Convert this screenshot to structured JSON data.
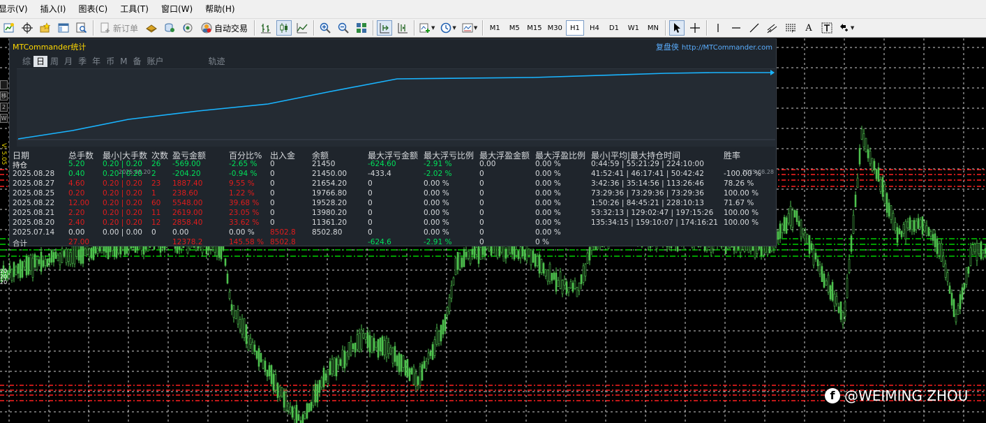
{
  "menu": [
    "显示(V)",
    "插入(I)",
    "图表(C)",
    "工具(T)",
    "窗口(W)",
    "帮助(H)"
  ],
  "toolbar": {
    "new_order": "新订单",
    "auto_trade": "自动交易",
    "timeframes": [
      "M1",
      "M5",
      "M15",
      "M30",
      "H1",
      "H4",
      "D1",
      "W1",
      "MN"
    ],
    "active_timeframe": "H1",
    "text_tool": "A"
  },
  "left_panel": {
    "tabs": [
      "",
      "移",
      "2",
      "W"
    ],
    "vertical_label": "V: 5.05",
    "price_ticks": [
      "20",
      "20",
      "20"
    ]
  },
  "panel": {
    "title": "MTCommander统计",
    "right_title": "复盘侠",
    "right_url": "http://MTCommander.com",
    "tabs": [
      "综",
      "日",
      "周",
      "月",
      "季",
      "年",
      "币",
      "M",
      "备",
      "账户",
      "轨迹"
    ],
    "active_tab": "日",
    "curve_date_left": "2025.08.20",
    "curve_date_right": "2025.08.28",
    "curve_color": "#19b4ff",
    "headers": [
      "日期",
      "总手数",
      "最小|大手数",
      "次数",
      "盈亏金额",
      "百分比%",
      "出入金",
      "余额",
      "最大浮亏金额",
      "最大浮亏比例",
      "最大浮盈金额",
      "最大浮盈比例",
      "最小|平均|最大持仓时间",
      "胜率"
    ],
    "rows": [
      {
        "date": "持仓",
        "lots": "5.20",
        "minmax": "0.20 | 0.20",
        "count": "26",
        "pnl": "-569.00",
        "pct": "-2.65 %",
        "io": "0",
        "balance": "21450",
        "max_loss": "-624.60",
        "max_loss_pct": "-2.91 %",
        "max_gain": "0.00",
        "max_gain_pct": "0.00 %",
        "hold": "0:44:59 | 55:21:29 | 224:10:00",
        "win": "",
        "tone": "g"
      },
      {
        "date": "2025.08.28",
        "lots": "0.40",
        "minmax": "0.20 | 0.20",
        "count": "2",
        "pnl": "-204.20",
        "pct": "-0.94 %",
        "io": "0",
        "balance": "21450.00",
        "max_loss": "-433.4",
        "max_loss_pct": "-2.02 %",
        "max_gain": "0",
        "max_gain_pct": "0.00 %",
        "hold": "41:52:41 | 46:17:41 | 50:42:42",
        "win": "-100.00 %",
        "tone": "g"
      },
      {
        "date": "2025.08.27",
        "lots": "4.60",
        "minmax": "0.20 | 0.20",
        "count": "23",
        "pnl": "1887.40",
        "pct": "9.55 %",
        "io": "0",
        "balance": "21654.20",
        "max_loss": "0",
        "max_loss_pct": "0.00 %",
        "max_gain": "0",
        "max_gain_pct": "0.00 %",
        "hold": "3:42:36 | 35:14:56 | 113:26:46",
        "win": "78.26 %",
        "tone": "r"
      },
      {
        "date": "2025.08.25",
        "lots": "0.20",
        "minmax": "0.20 | 0.20",
        "count": "1",
        "pnl": "238.60",
        "pct": "1.22 %",
        "io": "0",
        "balance": "19766.80",
        "max_loss": "0",
        "max_loss_pct": "0.00 %",
        "max_gain": "0",
        "max_gain_pct": "0.00 %",
        "hold": "73:29:36 | 73:29:36 | 73:29:36",
        "win": "100.00 %",
        "tone": "r"
      },
      {
        "date": "2025.08.22",
        "lots": "12.00",
        "minmax": "0.20 | 0.20",
        "count": "60",
        "pnl": "5548.00",
        "pct": "39.68 %",
        "io": "0",
        "balance": "19528.20",
        "max_loss": "0",
        "max_loss_pct": "0.00 %",
        "max_gain": "0",
        "max_gain_pct": "0.00 %",
        "hold": "1:50:26 | 84:45:21 | 228:10:13",
        "win": "71.67 %",
        "tone": "r"
      },
      {
        "date": "2025.08.21",
        "lots": "2.20",
        "minmax": "0.20 | 0.20",
        "count": "11",
        "pnl": "2619.00",
        "pct": "23.05 %",
        "io": "0",
        "balance": "13980.20",
        "max_loss": "0",
        "max_loss_pct": "0.00 %",
        "max_gain": "0",
        "max_gain_pct": "0.00 %",
        "hold": "53:32:13 | 129:02:47 | 197:15:26",
        "win": "100.00 %",
        "tone": "r"
      },
      {
        "date": "2025.08.20",
        "lots": "2.40",
        "minmax": "0.20 | 0.20",
        "count": "12",
        "pnl": "2858.40",
        "pct": "33.62 %",
        "io": "0",
        "balance": "11361.20",
        "max_loss": "0",
        "max_loss_pct": "0.00 %",
        "max_gain": "0",
        "max_gain_pct": "0.00 %",
        "hold": "135:34:15 | 159:10:07 | 174:16:21",
        "win": "100.00 %",
        "tone": "r"
      },
      {
        "date": "2025.07.14",
        "lots": "0.00",
        "minmax": "0.00 | 0.00",
        "count": "0",
        "pnl": "0.00",
        "pct": "0.00 %",
        "io": "8502.8",
        "balance": "8502.80",
        "max_loss": "0",
        "max_loss_pct": "0.00 %",
        "max_gain": "0",
        "max_gain_pct": "0.00 %",
        "hold": "",
        "win": "",
        "tone": "w"
      }
    ],
    "total": {
      "label": "合计",
      "lots": "27.00",
      "pnl": "12378.2",
      "pct": "145.58 %",
      "io": "8502.8",
      "max_loss": "-624.6",
      "max_loss_pct": "-2.91 %",
      "max_gain": "0",
      "max_gain_pct": "0 %"
    }
  },
  "watermark": "@WEIMING ZHOU",
  "colors": {
    "candle": "#4fc24f",
    "grid": "#ffffff",
    "level_red": "#ff2020",
    "level_green": "#00d000",
    "panel_bg": "#1f252c",
    "positive": "#00e05a",
    "negative": "#e01c1c"
  }
}
